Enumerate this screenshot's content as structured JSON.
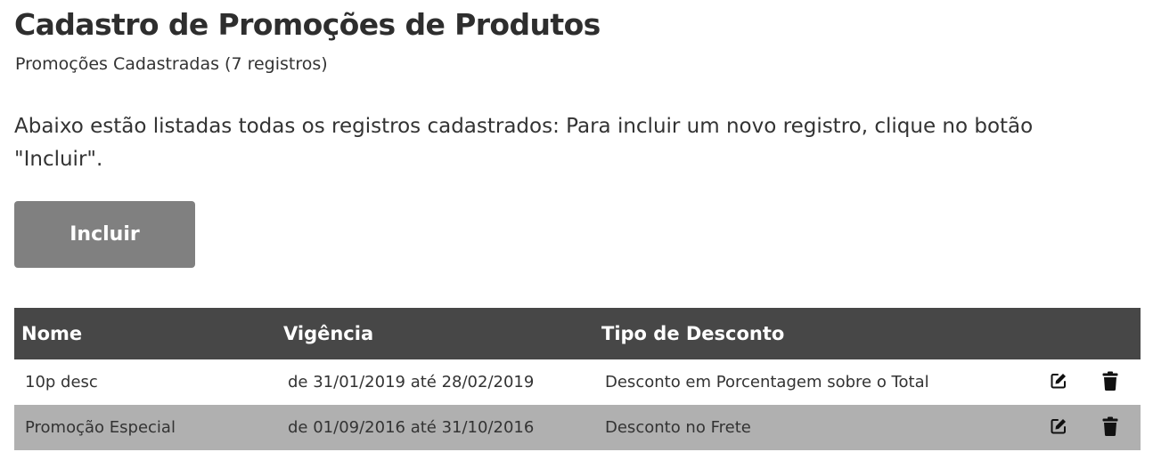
{
  "page": {
    "title": "Cadastro de Promoções de Produtos",
    "subtitle": "Promoções Cadastradas (7 registros)",
    "description": "Abaixo estão listadas todas os registros cadastrados: Para incluir um novo registro, clique no botão \"Incluir\"."
  },
  "toolbar": {
    "include_label": "Incluir"
  },
  "table": {
    "headers": {
      "name": "Nome",
      "validity": "Vigência",
      "discount_type": "Tipo de Desconto"
    },
    "rows": [
      {
        "name": "10p desc",
        "validity": "de 31/01/2019 até 28/02/2019",
        "discount_type": "Desconto em Porcentagem sobre o Total",
        "edit_icon": "edit-icon",
        "delete_icon": "trash-icon"
      },
      {
        "name": "Promoção Especial",
        "validity": "de 01/09/2016 até 31/10/2016",
        "discount_type": "Desconto no Frete",
        "edit_icon": "edit-icon",
        "delete_icon": "trash-icon"
      }
    ]
  },
  "colors": {
    "button": "#808080",
    "table_header": "#474747",
    "row_alt": "#b0b0b0",
    "text": "#333333"
  }
}
